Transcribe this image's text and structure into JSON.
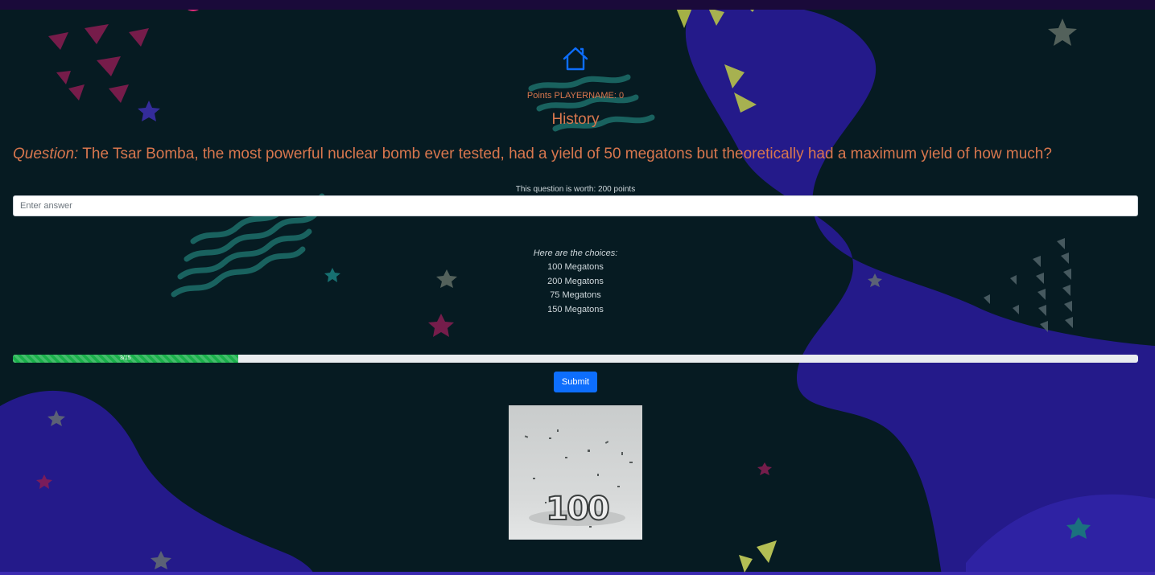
{
  "header": {
    "home_icon": "house-icon",
    "points_text": "Points PLAYERNAME: 0",
    "category": "History"
  },
  "question": {
    "label": "Question:",
    "text": "The Tsar Bomba, the most powerful nuclear bomb ever tested, had a yield of 50 megatons but theoretically had a maximum yield of how much?",
    "worth_text": "This question is worth: 200 points"
  },
  "answer": {
    "value": "",
    "placeholder": "Enter answer"
  },
  "choices": {
    "label": "Here are the choices:",
    "items": [
      "100 Megatons",
      "200 Megatons",
      "75 Megatons",
      "150 Megatons"
    ]
  },
  "progress": {
    "label": "3/15",
    "current": 3,
    "total": 15,
    "fraction": 0.2
  },
  "submit_label": "Submit",
  "celebration_image": {
    "text": "100"
  },
  "colors": {
    "background": "#061b22",
    "accent_text": "#d9774e",
    "primary_button": "#0d6efd",
    "progress_fill": "#1ab04b",
    "blob": "#2a1c8f"
  }
}
